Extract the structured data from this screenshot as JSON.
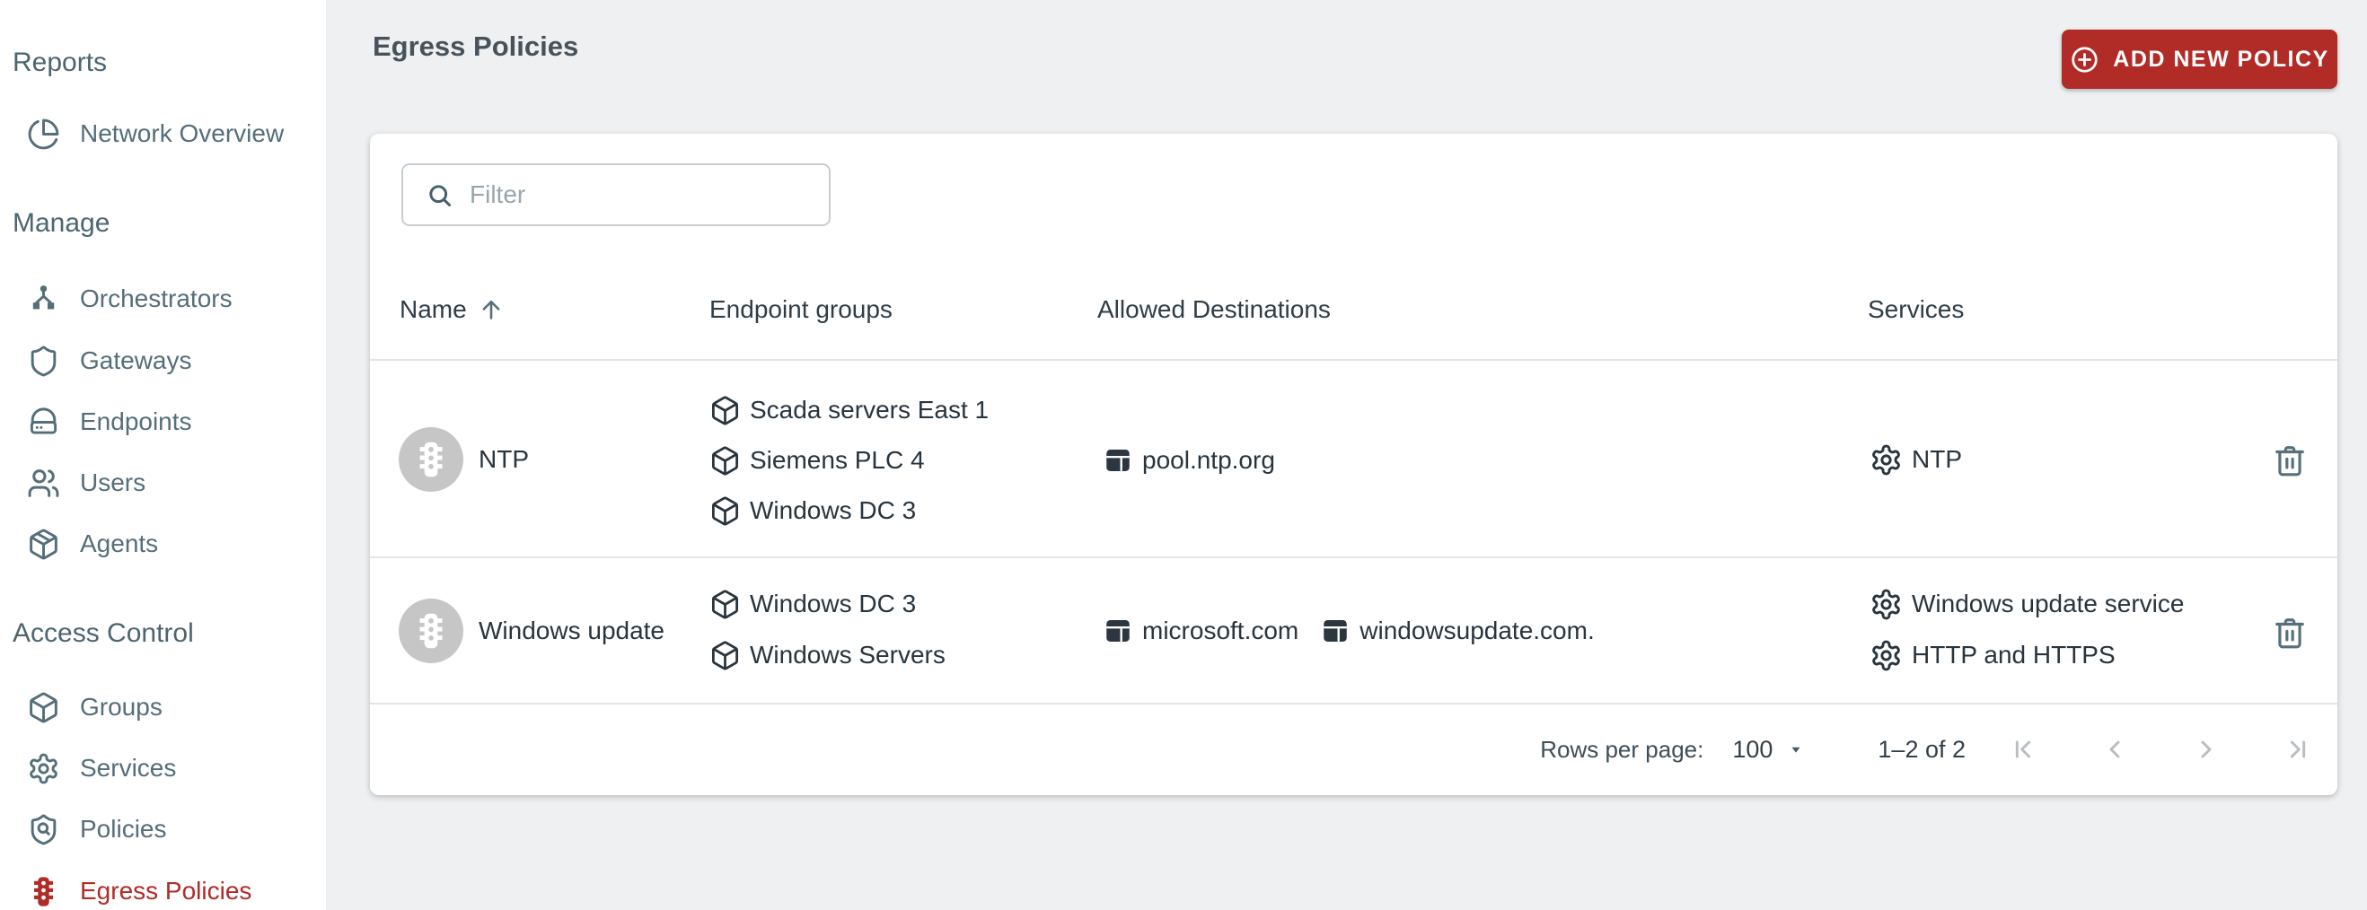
{
  "colors": {
    "accent_red": "#b12b27",
    "sidebar_text": "#546e7a",
    "table_text": "#28343e",
    "background": "#eef0f2",
    "avatar_gray": "#c6c6c6"
  },
  "sidebar": {
    "sections": [
      {
        "label": "Reports",
        "items": [
          {
            "label": "Network Overview",
            "icon": "pie-chart-icon",
            "active": false
          }
        ]
      },
      {
        "label": "Manage",
        "items": [
          {
            "label": "Orchestrators",
            "icon": "network-icon",
            "active": false
          },
          {
            "label": "Gateways",
            "icon": "shield-icon",
            "active": false
          },
          {
            "label": "Endpoints",
            "icon": "server-icon",
            "active": false
          },
          {
            "label": "Users",
            "icon": "users-icon",
            "active": false
          },
          {
            "label": "Agents",
            "icon": "package-icon",
            "active": false
          }
        ]
      },
      {
        "label": "Access Control",
        "items": [
          {
            "label": "Groups",
            "icon": "box-icon",
            "active": false
          },
          {
            "label": "Services",
            "icon": "gear-icon",
            "active": false
          },
          {
            "label": "Policies",
            "icon": "shield-search-icon",
            "active": false
          },
          {
            "label": "Egress Policies",
            "icon": "traffic-light-icon",
            "active": true
          }
        ]
      }
    ]
  },
  "header": {
    "title": "Egress Policies",
    "add_button": {
      "label": "ADD NEW POLICY",
      "icon": "plus-circle-icon"
    }
  },
  "filter": {
    "placeholder": "Filter",
    "icon": "search-icon"
  },
  "table": {
    "columns": [
      {
        "label": "Name",
        "sorted": "asc",
        "sort_icon": "arrow-up-icon"
      },
      {
        "label": "Endpoint groups"
      },
      {
        "label": "Allowed Destinations"
      },
      {
        "label": "Services"
      }
    ],
    "row_icons": {
      "policy_avatar": "traffic-light-icon",
      "endpoint_group": "box-icon",
      "destination": "browser-icon",
      "service": "gear-icon",
      "delete": "trash-icon"
    },
    "rows": [
      {
        "name": "NTP",
        "endpoint_groups": [
          "Scada servers East 1",
          "Siemens PLC 4",
          "Windows DC 3"
        ],
        "allowed_destinations": [
          "pool.ntp.org"
        ],
        "services": [
          "NTP"
        ]
      },
      {
        "name": "Windows update",
        "endpoint_groups": [
          "Windows DC 3",
          "Windows Servers"
        ],
        "allowed_destinations": [
          "microsoft.com",
          "windowsupdate.com."
        ],
        "services": [
          "Windows update service",
          "HTTP and HTTPS"
        ]
      }
    ]
  },
  "pagination": {
    "rows_per_page_label": "Rows per page:",
    "rows_per_page_value": "100",
    "range_label": "1–2 of 2",
    "nav_icons": [
      "first-page-icon",
      "previous-page-icon",
      "next-page-icon",
      "last-page-icon"
    ]
  }
}
